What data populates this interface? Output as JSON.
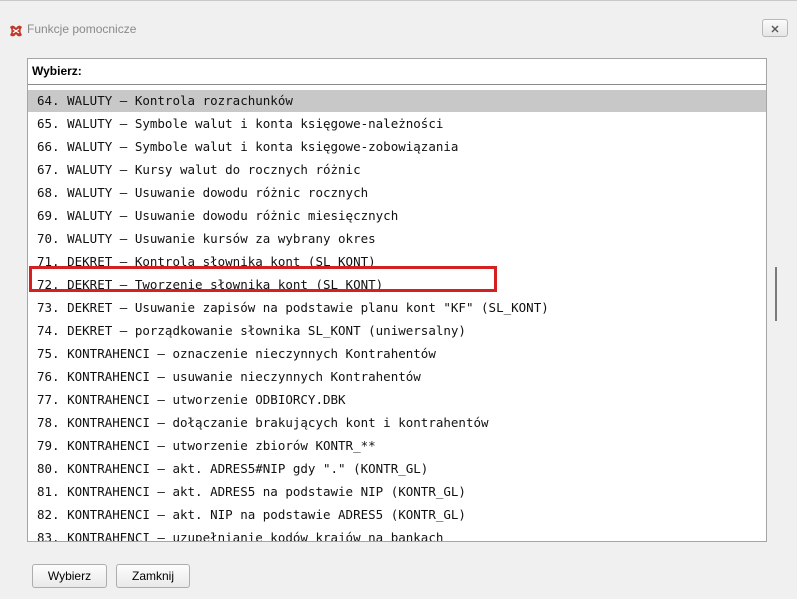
{
  "window": {
    "title": "Funkcje pomocnicze",
    "close_icon": "close-icon"
  },
  "group": {
    "label": "Wybierz:"
  },
  "list": {
    "selected_index": 0,
    "highlighted_index": 8,
    "items": [
      "64. WALUTY – Kontrola rozrachunków",
      "65. WALUTY – Symbole walut i konta księgowe-należności",
      "66. WALUTY – Symbole walut i konta księgowe-zobowiązania",
      "67. WALUTY – Kursy walut do rocznych różnic",
      "68. WALUTY – Usuwanie dowodu różnic rocznych",
      "69. WALUTY – Usuwanie dowodu różnic miesięcznych",
      "70. WALUTY – Usuwanie kursów za wybrany okres",
      "71. DEKRET – Kontrola słownika kont (SL KONT)",
      "72. DEKRET – Tworzenie słownika kont (SL_KONT)",
      "73. DEKRET – Usuwanie zapisów na podstawie planu kont \"KF\" (SL_KONT)",
      "74. DEKRET – porządkowanie słownika SL_KONT (uniwersalny)",
      "75. KONTRAHENCI – oznaczenie nieczynnych Kontrahentów",
      "76. KONTRAHENCI – usuwanie nieczynnych Kontrahentów",
      "77. KONTRAHENCI – utworzenie ODBIORCY.DBK",
      "78. KONTRAHENCI – dołączanie brakujących kont i kontrahentów",
      "79. KONTRAHENCI – utworzenie zbiorów KONTR_**",
      "80. KONTRAHENCI – akt. ADRES5#NIP gdy \".\" (KONTR_GL)",
      "81. KONTRAHENCI – akt. ADRES5 na podstawie NIP (KONTR_GL)",
      "82. KONTRAHENCI – akt. NIP na podstawie ADRES5 (KONTR_GL)",
      "83. KONTRAHENCI – uzupełnianie kodów krajów na bankach"
    ]
  },
  "buttons": {
    "select_label": "Wybierz",
    "close_label": "Zamknij"
  }
}
